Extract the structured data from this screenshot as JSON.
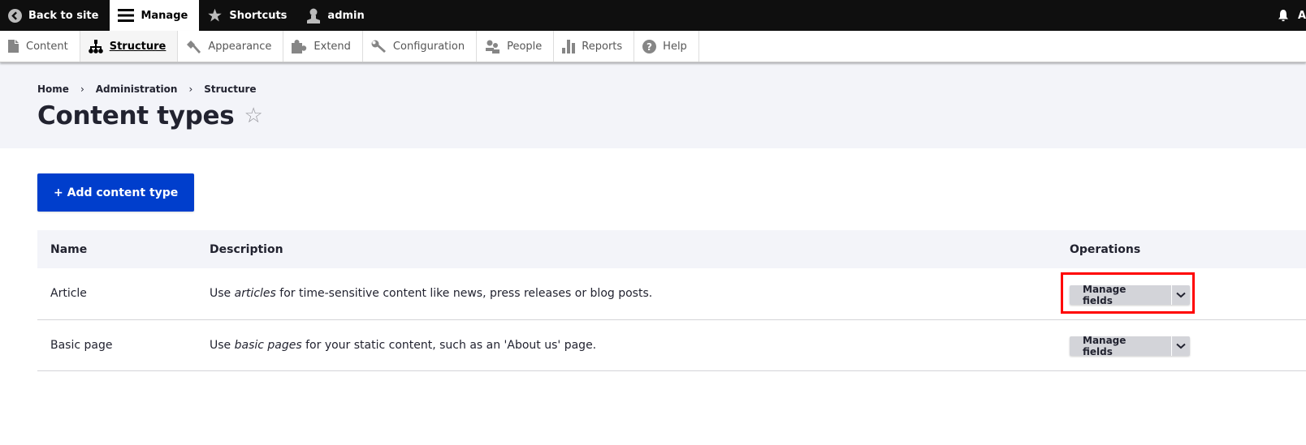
{
  "toolbar": {
    "back_to_site": "Back to site",
    "manage": "Manage",
    "shortcuts": "Shortcuts",
    "user": "admin",
    "right_clip": "A"
  },
  "tray": {
    "items": [
      {
        "label": "Content",
        "icon": "file-icon"
      },
      {
        "label": "Structure",
        "icon": "sitemap-icon",
        "active": true
      },
      {
        "label": "Appearance",
        "icon": "paintbrush-icon"
      },
      {
        "label": "Extend",
        "icon": "puzzle-icon"
      },
      {
        "label": "Configuration",
        "icon": "wrench-icon"
      },
      {
        "label": "People",
        "icon": "people-icon"
      },
      {
        "label": "Reports",
        "icon": "bar-chart-icon"
      },
      {
        "label": "Help",
        "icon": "help-icon"
      }
    ]
  },
  "breadcrumb": {
    "items": [
      "Home",
      "Administration",
      "Structure"
    ],
    "separator": "›"
  },
  "page": {
    "title": "Content types",
    "shortcut_star": "☆"
  },
  "actions": {
    "add_label": "+ Add content type"
  },
  "table": {
    "headers": [
      "Name",
      "Description",
      "Operations"
    ],
    "rows": [
      {
        "name": "Article",
        "desc_pre": "Use ",
        "desc_em": "articles",
        "desc_post": " for time-sensitive content like news, press releases or blog posts.",
        "operation": "Manage fields"
      },
      {
        "name": "Basic page",
        "desc_pre": "Use ",
        "desc_em": "basic pages",
        "desc_post": " for your static content, such as an 'About us' page.",
        "operation": "Manage fields"
      }
    ]
  },
  "colors": {
    "toolbar_bg": "#0f0f0f",
    "primary_button": "#003ecc",
    "header_bg": "#f3f4f9",
    "highlight": "#ff0000"
  }
}
